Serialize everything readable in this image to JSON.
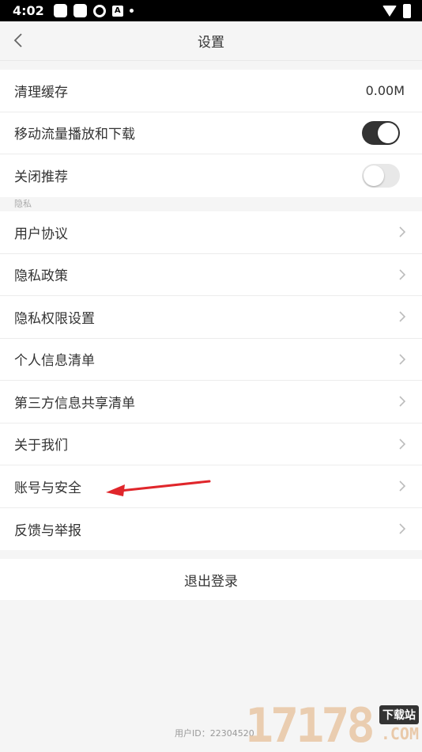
{
  "status_bar": {
    "time": "4:02",
    "icons_left": [
      "app-icon",
      "app-icon",
      "sync-icon",
      "a-icon",
      "dot-icon"
    ],
    "icons_right": [
      "wifi-icon",
      "battery-icon"
    ]
  },
  "nav": {
    "title": "设置",
    "back_icon": "chevron-left-icon"
  },
  "general": {
    "clear_cache_label": "清理缓存",
    "clear_cache_value": "0.00M",
    "mobile_data_label": "移动流量播放和下载",
    "mobile_data_on": true,
    "recommend_label": "关闭推荐",
    "recommend_on": false
  },
  "privacy": {
    "section_label": "隐私",
    "items": [
      {
        "label": "用户协议"
      },
      {
        "label": "隐私政策"
      },
      {
        "label": "隐私权限设置"
      },
      {
        "label": "个人信息清单"
      },
      {
        "label": "第三方信息共享清单"
      },
      {
        "label": "关于我们"
      },
      {
        "label": "账号与安全"
      },
      {
        "label": "反馈与举报"
      }
    ]
  },
  "logout_label": "退出登录",
  "user_id_text": "用户ID：22304520",
  "watermark": {
    "digits": "17178",
    "tag": "下载站",
    "domain": ".COM"
  },
  "colors": {
    "annotation_arrow": "#e0262b",
    "toggle_on": "#333333",
    "toggle_off": "#e8e8e8",
    "background": "#f5f5f5"
  }
}
